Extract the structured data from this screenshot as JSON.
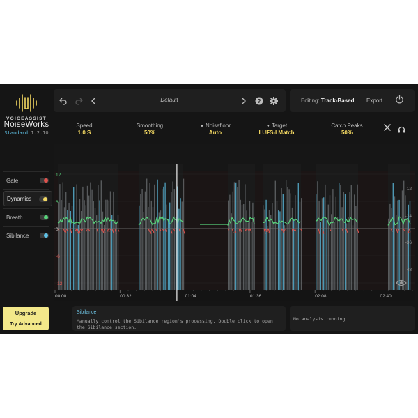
{
  "brand": {
    "tagline": "VOICEASSIST",
    "name": "NoiseWorks",
    "edition": "Standard",
    "version": "1.2.10"
  },
  "toolbar": {
    "preset_name": "Default",
    "icons": [
      "undo-icon",
      "redo-icon",
      "chevron-left-icon",
      "chevron-right-icon",
      "help-icon",
      "gear-icon"
    ]
  },
  "editing": {
    "label": "Editing:",
    "mode": "Track-Based",
    "export_label": "Export"
  },
  "params": [
    {
      "label": "Speed",
      "value": "1.0 S",
      "dropdown": false
    },
    {
      "label": "Smoothing",
      "value": "50%",
      "dropdown": false
    },
    {
      "label": "Noisefloor",
      "value": "Auto",
      "dropdown": true
    },
    {
      "label": "Target",
      "value": "LUFS-I Match",
      "dropdown": true
    },
    {
      "label": "Catch Peaks",
      "value": "50%",
      "dropdown": false
    }
  ],
  "sidebar": {
    "items": [
      {
        "label": "Gate",
        "dot_color": "#e0524d",
        "active": false
      },
      {
        "label": "Dynamics",
        "dot_color": "#f3d862",
        "active": true
      },
      {
        "label": "Breath",
        "dot_color": "#57d27a",
        "active": false
      },
      {
        "label": "Sibilance",
        "dot_color": "#5fc2e6",
        "active": false
      }
    ]
  },
  "upgrade": {
    "upgrade_label": "Upgrade",
    "try_label": "Try Advanced"
  },
  "chart_data": {
    "type": "line",
    "x_ticks": [
      "00:00",
      "00:32",
      "01:04",
      "01:36",
      "02:08",
      "02:40"
    ],
    "left_ticks": [
      "12",
      "6",
      "0",
      "-6",
      "-12"
    ],
    "right_ticks": [
      "-12",
      "-24",
      "-36",
      "-48"
    ],
    "playhead_time": "01:00",
    "colors": {
      "gain_up": "#57d27a",
      "gain_down": "#e0524d",
      "waveform": "#8a8f94",
      "sibilance": "#5fc2e6"
    }
  },
  "info": {
    "title": "Sibilance",
    "description": "Manually control the Sibilance region's processing. Double click to open the Sibilance section."
  },
  "status": {
    "text": "No analysis running."
  }
}
